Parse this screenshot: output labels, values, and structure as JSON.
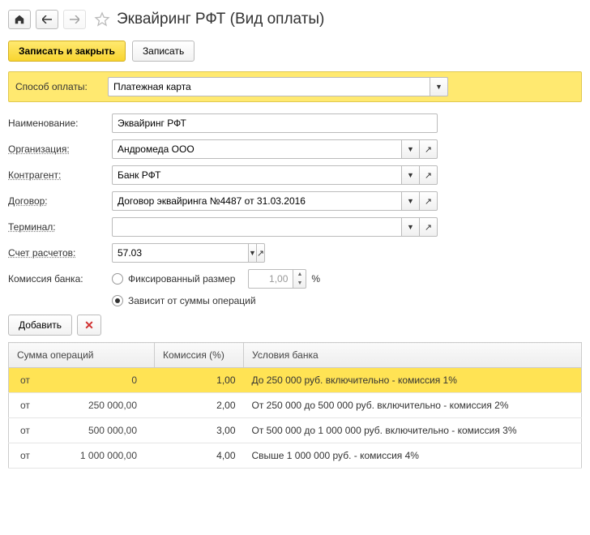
{
  "title": "Эквайринг РФТ (Вид оплаты)",
  "toolbar": {
    "save_close": "Записать и закрыть",
    "save": "Записать"
  },
  "payment_method": {
    "label": "Способ оплаты:",
    "value": "Платежная карта"
  },
  "fields": {
    "name": {
      "label": "Наименование:",
      "value": "Эквайринг РФТ"
    },
    "org": {
      "label": "Организация:",
      "value": "Андромеда ООО"
    },
    "counterparty": {
      "label": "Контрагент:",
      "value": "Банк РФТ"
    },
    "contract": {
      "label": "Договор:",
      "value": "Договор эквайринга №4487 от 31.03.2016"
    },
    "terminal": {
      "label": "Терминал:",
      "value": ""
    },
    "account": {
      "label": "Счет расчетов:",
      "value": "57.03"
    }
  },
  "commission": {
    "label": "Комиссия банка:",
    "fixed_label": "Фиксированный размер",
    "fixed_value": "1,00",
    "pct_sign": "%",
    "depends_label": "Зависит от суммы операций"
  },
  "actions": {
    "add": "Добавить"
  },
  "table": {
    "headers": {
      "sum": "Сумма операций",
      "commission": "Комиссия (%)",
      "conditions": "Условия банка"
    },
    "from_label": "от",
    "rows": [
      {
        "sum": "0",
        "commission": "1,00",
        "cond": "До 250 000 руб. включительно - комиссия 1%",
        "selected": true
      },
      {
        "sum": "250 000,00",
        "commission": "2,00",
        "cond": "От 250 000 до 500 000 руб. включительно - комиссия 2%",
        "selected": false
      },
      {
        "sum": "500 000,00",
        "commission": "3,00",
        "cond": "От 500 000 до 1 000 000 руб. включительно - комиссия 3%",
        "selected": false
      },
      {
        "sum": "1 000 000,00",
        "commission": "4,00",
        "cond": "Свыше 1 000 000 руб. - комиссия 4%",
        "selected": false
      }
    ]
  }
}
